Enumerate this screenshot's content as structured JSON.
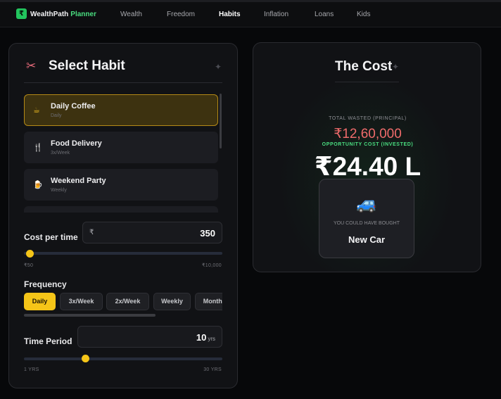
{
  "app": {
    "logo_glyph": "₹",
    "brand_part1": "WealthPath",
    "brand_part2": "Planner"
  },
  "nav": [
    {
      "label": "Wealth",
      "active": false
    },
    {
      "label": "Freedom",
      "active": false
    },
    {
      "label": "Habits",
      "active": true
    },
    {
      "label": "Inflation",
      "active": false
    },
    {
      "label": "Loans",
      "active": false
    },
    {
      "label": "Kids",
      "active": false
    }
  ],
  "select_panel": {
    "icon": "scissors-icon",
    "title": "Select Habit",
    "habits": [
      {
        "name": "Daily Coffee",
        "frequency": "Daily",
        "icon": "coffee-cup-icon",
        "active": true
      },
      {
        "name": "Food Delivery",
        "frequency": "3x/Week",
        "icon": "fork-knife-icon",
        "active": false
      },
      {
        "name": "Weekend Party",
        "frequency": "Weekly",
        "icon": "drink-icon",
        "active": false
      }
    ],
    "cost": {
      "label": "Cost per time",
      "currency": "₹",
      "value": "350",
      "min_label": "₹50",
      "max_label": "₹10,000",
      "slider_fraction": 0.03
    },
    "frequency": {
      "label": "Frequency",
      "options": [
        "Daily",
        "3x/Week",
        "2x/Week",
        "Weekly",
        "Monthly"
      ],
      "selected": "Daily"
    },
    "period": {
      "label": "Time Period",
      "value": "10",
      "unit": "yrs",
      "min_label": "1 YRS",
      "max_label": "30 YRS",
      "slider_fraction": 0.31
    }
  },
  "cost_panel": {
    "title": "The Cost",
    "wasted_label": "TOTAL WASTED (PRINCIPAL)",
    "wasted_value": "₹12,60,000",
    "opportunity_label": "OPPORTUNITY COST (INVESTED)",
    "opportunity_value": "₹24.40 L",
    "card": {
      "icon": "car-icon",
      "caption": "YOU COULD HAVE BOUGHT",
      "item": "New Car"
    }
  },
  "colors": {
    "accent": "#f5c518",
    "brand_green": "#22c55e",
    "wasted_red": "#ef6b6b",
    "opportunity_green": "#4ade80"
  }
}
